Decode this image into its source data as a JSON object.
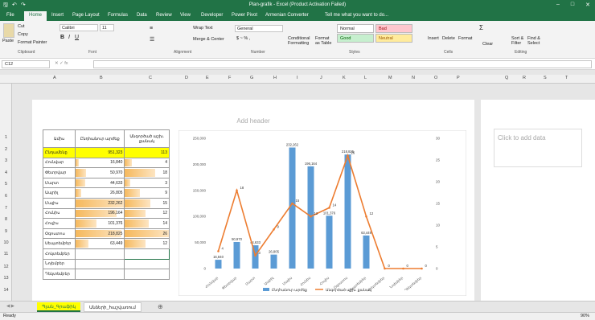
{
  "title": "Plan-grafik - Excel (Product Activation Failed)",
  "tabs": [
    "File",
    "Home",
    "Insert",
    "Page Layout",
    "Formulas",
    "Data",
    "Review",
    "View",
    "Developer",
    "Power Pivot",
    "Armenian Converter",
    "Tell me what you want to do..."
  ],
  "ribbon": {
    "clipboard": {
      "paste": "Paste",
      "cut": "Cut",
      "copy": "Copy",
      "painter": "Format Painter",
      "label": "Clipboard"
    },
    "font": {
      "name": "Calibri",
      "size": "11",
      "label": "Font"
    },
    "alignment": {
      "wrap": "Wrap Text",
      "merge": "Merge & Center",
      "label": "Alignment"
    },
    "number": {
      "format": "General",
      "label": "Number"
    },
    "styles": {
      "cond": "Conditional Formatting",
      "table": "Format as Table",
      "normal": "Normal",
      "bad": "Bad",
      "good": "Good",
      "neutral": "Neutral",
      "label": "Styles"
    },
    "cells": {
      "insert": "Insert",
      "delete": "Delete",
      "format": "Format",
      "label": "Cells"
    },
    "editing": {
      "clear": "Clear",
      "sort": "Sort & Filter",
      "find": "Find & Select",
      "label": "Editing"
    }
  },
  "namebox": "C12",
  "columns": [
    "A",
    "B",
    "C",
    "D",
    "E",
    "F",
    "G",
    "H",
    "I",
    "J",
    "K",
    "L",
    "M",
    "N",
    "O",
    "P",
    "Q",
    "R",
    "S",
    "T"
  ],
  "rows": [
    "1",
    "2",
    "3",
    "4",
    "5",
    "6",
    "7",
    "8",
    "9",
    "10",
    "11",
    "12",
    "13",
    "14"
  ],
  "page": {
    "header": "Add header",
    "click_data": "Click to add data"
  },
  "table": {
    "headers": [
      "Ամիս",
      "Ընդհանուր արժեք",
      "Անգործած աշխ. քանակ"
    ],
    "rows": [
      {
        "m": "Ընդամենը",
        "v": "951,323",
        "n": "113"
      },
      {
        "m": "Հունվար",
        "v": "16,840",
        "n": "4"
      },
      {
        "m": "Փետրվար",
        "v": "50,970",
        "n": "18"
      },
      {
        "m": "Մարտ",
        "v": "44,633",
        "n": "3"
      },
      {
        "m": "Ապրիլ",
        "v": "26,805",
        "n": "9"
      },
      {
        "m": "Մայիս",
        "v": "232,262",
        "n": "15"
      },
      {
        "m": "Հունիս",
        "v": "196,164",
        "n": "12"
      },
      {
        "m": "Հուլիս",
        "v": "101,376",
        "n": "14"
      },
      {
        "m": "Օգոստոս",
        "v": "218,825",
        "n": "26"
      },
      {
        "m": "Սեպտեմբեր",
        "v": "63,449",
        "n": "12"
      },
      {
        "m": "Հոկտեմբեր",
        "v": "",
        "n": ""
      },
      {
        "m": "Նոյեմբեր",
        "v": "",
        "n": ""
      },
      {
        "m": "Դեկտեմբեր",
        "v": "",
        "n": ""
      }
    ]
  },
  "chart_data": {
    "type": "bar",
    "categories": [
      "Հունվար",
      "Փետրվար",
      "Մարտ",
      "Ապրիլ",
      "Մայիս",
      "Հունիս",
      "Հուլիս",
      "Օգոստոս",
      "Սեպտեմբեր",
      "Հոկտեմբեր",
      "Նոյեմբեր",
      "Դեկտեմբեր"
    ],
    "series": [
      {
        "name": "Ընդհանուր արժեք",
        "type": "bar",
        "values": [
          16840,
          50970,
          44633,
          26805,
          232262,
          196164,
          101376,
          218825,
          63449,
          0,
          0,
          0
        ],
        "labels": [
          "16,840",
          "50,970",
          "44,633",
          "26,805",
          "232,262",
          "196,164",
          "101,376",
          "218,825",
          "63,449",
          "",
          "",
          ""
        ]
      },
      {
        "name": "Անգործած աշխ. քանակ",
        "type": "line",
        "values": [
          4,
          18,
          3,
          9,
          15,
          12,
          14,
          26,
          12,
          0,
          0,
          0
        ],
        "axis": "right"
      }
    ],
    "yticks": [
      "0",
      "50,000",
      "100,000",
      "150,000",
      "200,000",
      "250,000"
    ],
    "y2ticks": [
      "0",
      "5",
      "10",
      "15",
      "20",
      "25",
      "30"
    ],
    "ylim": [
      0,
      250000
    ],
    "y2lim": [
      0,
      30
    ],
    "bar_color": "#5b9bd5",
    "line_color": "#ed7d31"
  },
  "sheets": [
    "Պլան_Գրաֆիկ",
    "Անձերի_հաշվառում"
  ],
  "status": {
    "ready": "Ready",
    "zoom": "90%"
  }
}
